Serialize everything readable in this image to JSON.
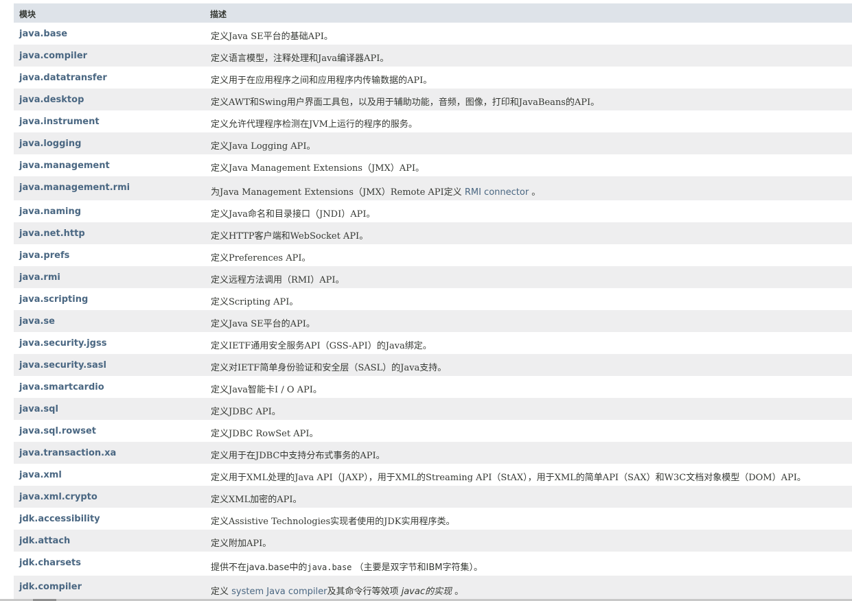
{
  "header": {
    "col_module": "模块",
    "col_description": "描述"
  },
  "rows": [
    {
      "module": "java.base",
      "desc": "定义Java SE平台的基础API。"
    },
    {
      "module": "java.compiler",
      "desc": "定义语言模型，注释处理和Java编译器API。"
    },
    {
      "module": "java.datatransfer",
      "desc": "定义用于在应用程序之间和应用程序内传输数据的API。"
    },
    {
      "module": "java.desktop",
      "desc": "定义AWT和Swing用户界面工具包，以及用于辅助功能，音频，图像，打印和JavaBeans的API。"
    },
    {
      "module": "java.instrument",
      "desc": "定义允许代理程序检测在JVM上运行的程序的服务。"
    },
    {
      "module": "java.logging",
      "desc": "定义Java Logging API。"
    },
    {
      "module": "java.management",
      "desc": "定义Java Management Extensions（JMX）API。"
    },
    {
      "module": "java.management.rmi",
      "desc_pre": "为Java Management Extensions（JMX）Remote API定义 ",
      "desc_link": "RMI connector",
      "desc_post": " 。"
    },
    {
      "module": "java.naming",
      "desc": "定义Java命名和目录接口（JNDI）API。"
    },
    {
      "module": "java.net.http",
      "desc": "定义HTTP客户端和WebSocket API。"
    },
    {
      "module": "java.prefs",
      "desc": "定义Preferences API。"
    },
    {
      "module": "java.rmi",
      "desc": "定义远程方法调用（RMI）API。"
    },
    {
      "module": "java.scripting",
      "desc": "定义Scripting API。"
    },
    {
      "module": "java.se",
      "desc": "定义Java SE平台的API。"
    },
    {
      "module": "java.security.jgss",
      "desc": "定义IETF通用安全服务API（GSS-API）的Java绑定。"
    },
    {
      "module": "java.security.sasl",
      "desc": "定义对IETF简单身份验证和安全层（SASL）的Java支持。"
    },
    {
      "module": "java.smartcardio",
      "desc": "定义Java智能卡I / O API。"
    },
    {
      "module": "java.sql",
      "desc": "定义JDBC API。"
    },
    {
      "module": "java.sql.rowset",
      "desc": "定义JDBC RowSet API。"
    },
    {
      "module": "java.transaction.xa",
      "desc": "定义用于在JDBC中支持分布式事务的API。"
    },
    {
      "module": "java.xml",
      "desc": "定义用于XML处理的Java API（JAXP），用于XML的Streaming API（StAX），用于XML的简单API（SAX）和W3C文档对象模型（DOM）API。"
    },
    {
      "module": "java.xml.crypto",
      "desc": "定义XML加密的API。"
    },
    {
      "module": "jdk.accessibility",
      "desc": "定义Assistive Technologies实现者使用的JDK实用程序类。"
    },
    {
      "module": "jdk.attach",
      "desc": "定义附加API。"
    },
    {
      "module": "jdk.charsets",
      "desc_pre": "提供不在java.base中的",
      "desc_code": "java.base",
      "desc_post": " （主要是双字节和IBM字符集）。"
    },
    {
      "module": "jdk.compiler",
      "desc_pre": "定义 ",
      "desc_link": "system Java compiler",
      "desc_mid": "及其命令行等效项 ",
      "desc_ital": "javac的实现",
      "desc_post": " 。"
    }
  ]
}
